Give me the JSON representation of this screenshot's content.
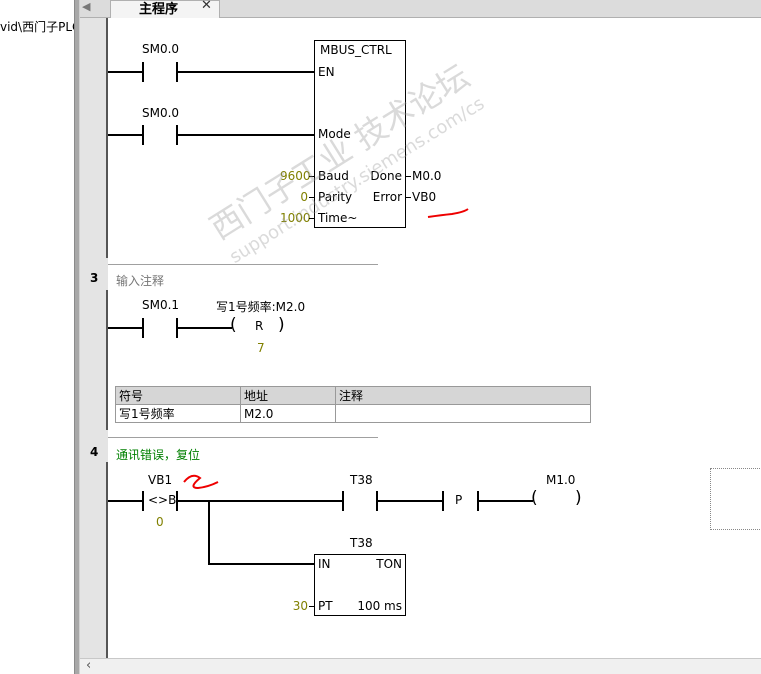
{
  "left_pane": {
    "path_text": "vid\\西门子PLC"
  },
  "tabs": [
    {
      "label": "主程序"
    }
  ],
  "network2": {
    "contact1": "SM0.0",
    "contact2": "SM0.0",
    "block": {
      "name": "MBUS_CTRL",
      "en": "EN",
      "mode": "Mode",
      "baud": "Baud",
      "parity": "Parity",
      "time": "Time~",
      "done": "Done",
      "error": "Error",
      "baud_val": "9600",
      "parity_val": "0",
      "time_val": "1000",
      "done_out": "M0.0",
      "error_out": "VB0"
    }
  },
  "network3": {
    "number": "3",
    "comment": "输入注释",
    "contact": "SM0.1",
    "coil_symbol": "写1号频率:M2.0",
    "coil_type": "R",
    "coil_count": "7",
    "symbol_table": {
      "headers": [
        "符号",
        "地址",
        "注释"
      ],
      "rows": [
        [
          "写1号频率",
          "M2.0",
          ""
        ]
      ]
    }
  },
  "network4": {
    "number": "4",
    "comment": "通讯错误，复位",
    "compare_operand": "VB1",
    "compare_op": "<>B",
    "compare_value": "0",
    "contact2": "T38",
    "p_label": "P",
    "coil_addr": "M1.0",
    "timer_name": "T38",
    "timer_in": "IN",
    "timer_type": "TON",
    "timer_pt": "PT",
    "timer_preset": "30",
    "timer_base": "100 ms"
  },
  "watermark": {
    "line1": "西门子工业 技术论坛",
    "line2": "support.industry.siemens.com/cs"
  },
  "colors": {
    "annotation_red": "#e00000",
    "operand_olive": "#808000",
    "comment_green": "#008000"
  }
}
